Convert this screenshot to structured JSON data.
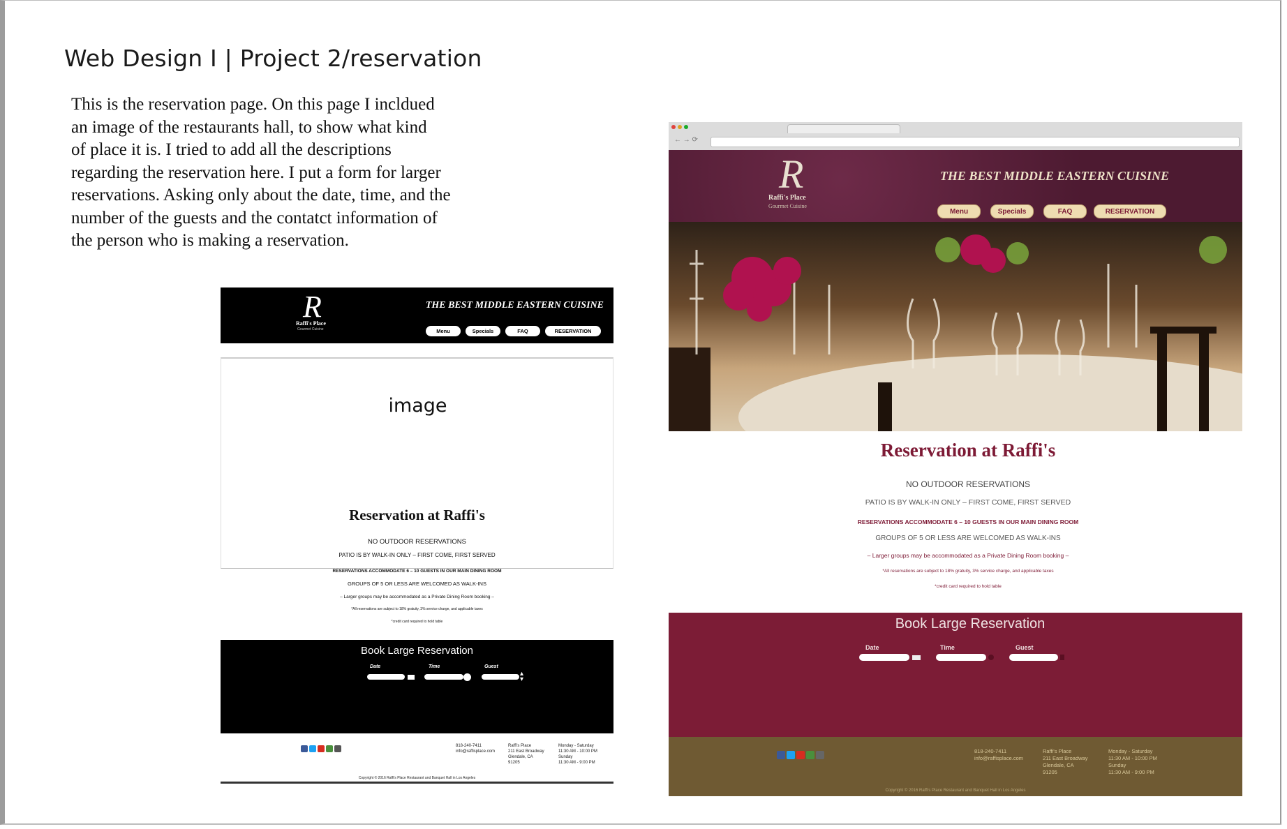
{
  "document": {
    "title": "Web Design I | Project 2/reservation",
    "description_lines": [
      "This is the reservation page. On this page I incldued",
      "an image of the restaurants hall, to show what kind",
      "of place it is. I tried to add all the descriptions",
      "regarding the reservation here. I put a form for larger",
      "reservations. Asking only about the date, time, and the",
      "number of the guests and the contatct information of",
      "the person who is making a reservation."
    ]
  },
  "wireframe": {
    "logo_letter": "R",
    "logo_name": "Raffi's Place",
    "logo_sub": "Gourmet Cuisine",
    "tagline": "THE BEST MIDDLE EASTERN CUISINE",
    "nav": [
      "Menu",
      "Specials",
      "FAQ",
      "RESERVATION"
    ],
    "image_label": "image",
    "reservation_title": "Reservation at Raffi's",
    "info_lines": [
      "NO OUTDOOR RESERVATIONS",
      "PATIO IS BY WALK-IN ONLY – FIRST COME, FIRST SERVED",
      "RESERVATIONS ACCOMMODATE 6 – 10 GUESTS IN OUR MAIN DINING ROOM",
      "GROUPS OF 5 OR LESS ARE WELCOMED AS WALK-INS",
      "– Larger groups may be accommodated as a Private Dining Room booking –",
      "*All reservations are subject to 18% gratuity, 3% service charge, and applicable taxes",
      "*credit card required to hold table"
    ],
    "book_title": "Book Large Reservation",
    "form_labels": [
      "Date",
      "Time",
      "Guest"
    ],
    "footer_phone": "818-240-7411\ninfo@raffisplace.com",
    "footer_address": "Raffi's Place\n211 East Broadway\nGlendale, CA\n91205",
    "footer_hours": "Monday - Saturday\n11:30 AM - 10:00 PM\nSunday\n11:30 AM - 9:00 PM",
    "copyright": "Copyright © 2016 Raffi's Place Restaurant and Banquet Hall in Los Angeles"
  },
  "website": {
    "logo_letter": "R",
    "logo_name": "Raffi's Place",
    "logo_sub": "Gourmet Cuisine",
    "tagline": "THE BEST MIDDLE EASTERN CUISINE",
    "nav": [
      "Menu",
      "Specials",
      "FAQ",
      "RESERVATION"
    ],
    "reservation_title": "Reservation at Raffi's",
    "info_lines": [
      "NO OUTDOOR RESERVATIONS",
      "PATIO IS BY WALK-IN ONLY – FIRST COME, FIRST SERVED",
      "RESERVATIONS ACCOMMODATE 6 – 10 GUESTS IN OUR MAIN DINING ROOM",
      "GROUPS OF 5 OR LESS ARE WELCOMED AS WALK-INS",
      "– Larger groups may be accommodated as a Private Dining Room booking –",
      "*All reservations are subject to 18% gratuity, 3% service charge, and applicable taxes",
      "*credit card required to hold table"
    ],
    "book_title": "Book Large Reservation",
    "form_labels": [
      "Date",
      "Time",
      "Guest"
    ],
    "footer_phone": "818-240-7411\ninfo@raffisplace.com",
    "footer_address": "Raffi's Place\n211 East Broadway\nGlendale, CA\n91205",
    "footer_hours": "Monday - Saturday\n11:30 AM - 10:00 PM\nSunday\n11:30 AM - 9:00 PM",
    "copyright": "Copyright © 2016 Raffi's Place Restaurant and Banquet Hall in Los Angeles"
  },
  "colors": {
    "burgundy": "#7c1c36",
    "header_purple": "#5a1f3a",
    "footer_olive": "#6f5a33",
    "button_cream": "#eedcb1"
  },
  "icons": [
    "facebook-icon",
    "twitter-icon",
    "youtube-icon",
    "google-plus-icon",
    "instagram-icon"
  ]
}
